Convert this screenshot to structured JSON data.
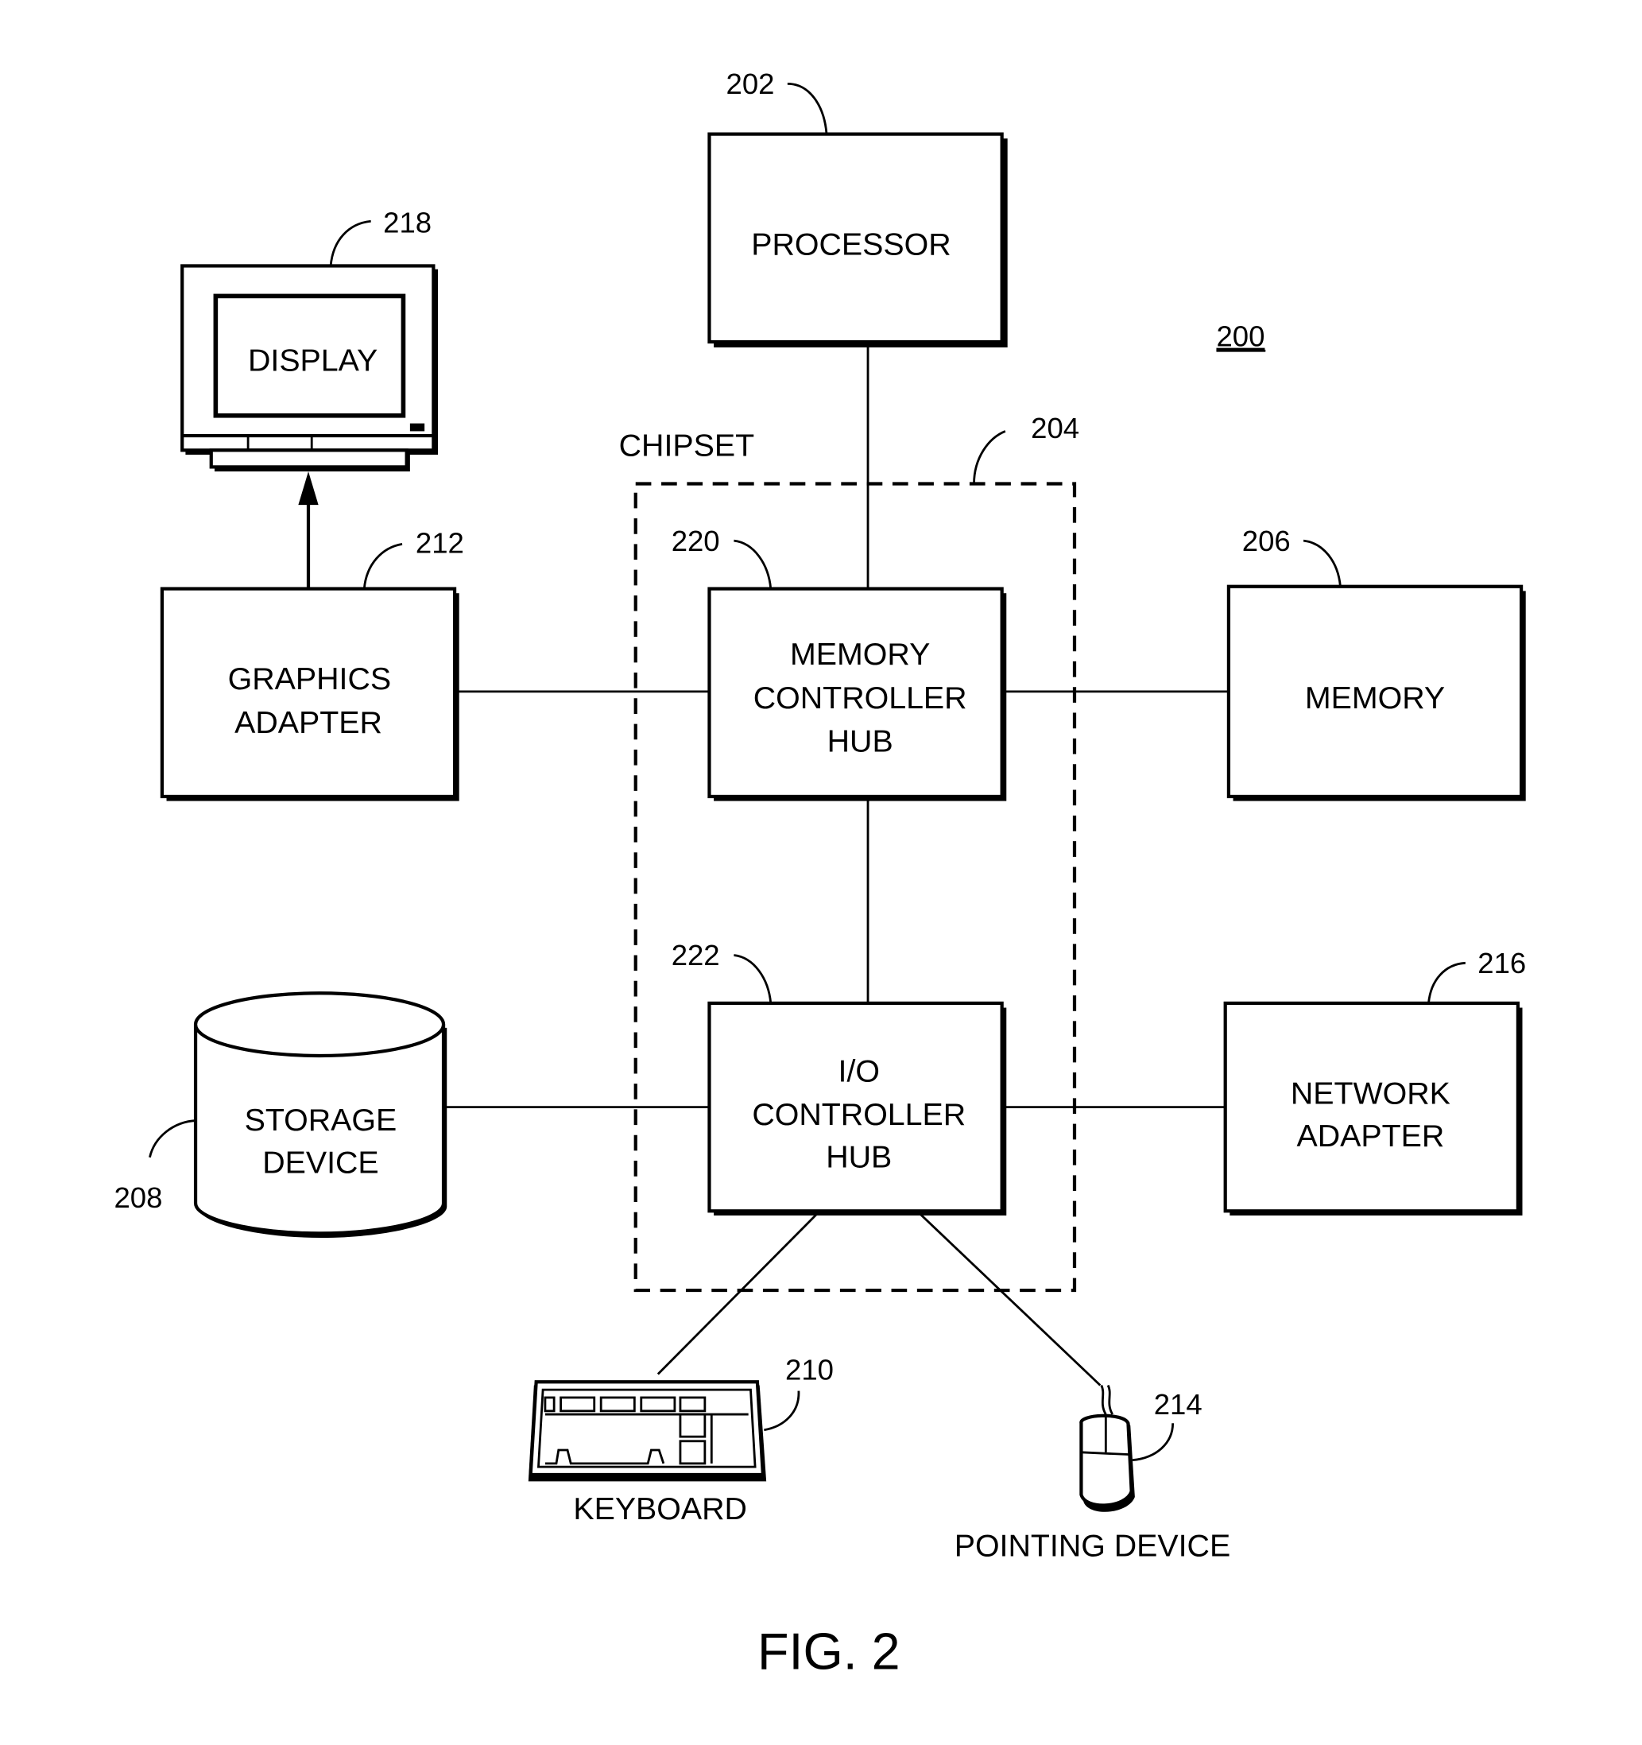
{
  "figure": {
    "title": "FIG. 2",
    "reference": "200"
  },
  "nodes": {
    "processor": {
      "label": "PROCESSOR",
      "ref": "202"
    },
    "chipset": {
      "label": "CHIPSET",
      "ref": "204"
    },
    "memory": {
      "label": "MEMORY",
      "ref": "206"
    },
    "storage": {
      "label_lines": [
        "STORAGE",
        "DEVICE"
      ],
      "ref": "208"
    },
    "keyboard": {
      "label": "KEYBOARD",
      "ref": "210"
    },
    "graphics_adapter": {
      "label_lines": [
        "GRAPHICS",
        "ADAPTER"
      ],
      "ref": "212"
    },
    "pointing_device": {
      "label": "POINTING DEVICE",
      "ref": "214"
    },
    "network_adapter": {
      "label_lines": [
        "NETWORK",
        "ADAPTER"
      ],
      "ref": "216"
    },
    "display": {
      "label": "DISPLAY",
      "ref": "218"
    },
    "memory_controller_hub": {
      "label_lines": [
        "MEMORY",
        "CONTROLLER",
        "HUB"
      ],
      "ref": "220"
    },
    "io_controller_hub": {
      "label_lines": [
        "I/O",
        "CONTROLLER",
        "HUB"
      ],
      "ref": "222"
    }
  },
  "connections": [
    [
      "processor",
      "memory_controller_hub"
    ],
    [
      "graphics_adapter",
      "memory_controller_hub"
    ],
    [
      "memory_controller_hub",
      "memory"
    ],
    [
      "memory_controller_hub",
      "io_controller_hub"
    ],
    [
      "storage",
      "io_controller_hub"
    ],
    [
      "io_controller_hub",
      "network_adapter"
    ],
    [
      "io_controller_hub",
      "keyboard"
    ],
    [
      "io_controller_hub",
      "pointing_device"
    ],
    [
      "graphics_adapter",
      "display"
    ]
  ]
}
